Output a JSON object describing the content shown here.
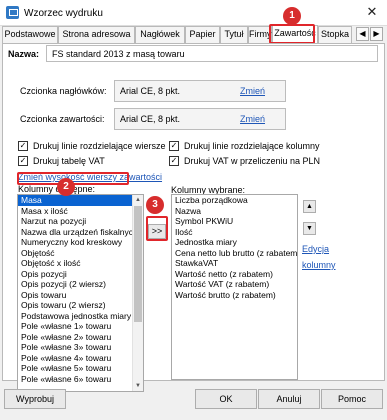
{
  "window": {
    "title": "Wzorzec wydruku",
    "close_symbol": "✕"
  },
  "tabs": [
    {
      "label": "Podstawowe"
    },
    {
      "label": "Strona adresowa"
    },
    {
      "label": "Nagłówek"
    },
    {
      "label": "Papier"
    },
    {
      "label": "Tytuł"
    },
    {
      "label": "Firmy"
    },
    {
      "label": "Zawartość"
    },
    {
      "label": "Stopka"
    }
  ],
  "tab_nav": {
    "prev": "◀",
    "next": "▶"
  },
  "name": {
    "label": "Nazwa:",
    "value": "FS standard 2013 z masą towaru"
  },
  "fonts": {
    "header_label": "Czcionka nagłówków:",
    "header_value": "Arial CE, 8 pkt.",
    "content_label": "Czcionka zawartości:",
    "content_value": "Arial CE, 8 pkt.",
    "change_link": "Zmień"
  },
  "checkboxes": [
    {
      "label": "Drukuj linie rozdzielające wiersze",
      "checked": true
    },
    {
      "label": "Drukuj linie rozdzielające kolumny",
      "checked": true
    },
    {
      "label": "Drukuj tabelę VAT",
      "checked": true
    },
    {
      "label": "Drukuj VAT w przeliczeniu na PLN",
      "checked": true
    }
  ],
  "check_mark": "✓",
  "row_height_link": "Zmień wysokość wierszy zawartości",
  "available": {
    "label": "Kolumny dostępne:",
    "items": [
      "Masa",
      "Masa x ilość",
      "Narzut na pozycji",
      "Nazwa dla urządzeń fiskalnych",
      "Numeryczny kod kreskowy",
      "Objętość",
      "Objętość x ilość",
      "Opis pozycji",
      "Opis pozycji (2 wiersz)",
      "Opis towaru",
      "Opis towaru (2 wiersz)",
      "Podstawowa jednostka miary",
      "Pole «własne 1» towaru",
      "Pole «własne 2» towaru",
      "Pole «własne 3» towaru",
      "Pole «własne 4» towaru",
      "Pole «własne 5» towaru",
      "Pole «własne 6» towaru"
    ],
    "selected_index": 0
  },
  "add_button": ">>",
  "selected": {
    "label": "Kolumny wybrane:",
    "items": [
      "Liczba porządkowa",
      "Nazwa",
      "Symbol PKWiU",
      "Ilość",
      "Jednostka miary",
      "Cena netto lub brutto (z rabatem)",
      "StawkaVAT",
      "Wartość netto (z rabatem)",
      "Wartość VAT (z rabatem)",
      "Wartość brutto (z rabatem)"
    ]
  },
  "move": {
    "up": "▲",
    "down": "▼"
  },
  "edit_link_line1": "Edycja",
  "edit_link_line2": "kolumny",
  "badges": {
    "one": "1",
    "two": "2",
    "three": "3"
  },
  "footer": {
    "print_btn": "Wyprobuj",
    "ok_btn": "OK",
    "cancel_btn": "Anuluj",
    "help_btn": "Pomoc"
  },
  "colors": {
    "highlight": "#e0262b",
    "badge": "#d72d2d",
    "selection": "#0a63d1",
    "link": "#1e56b7"
  }
}
